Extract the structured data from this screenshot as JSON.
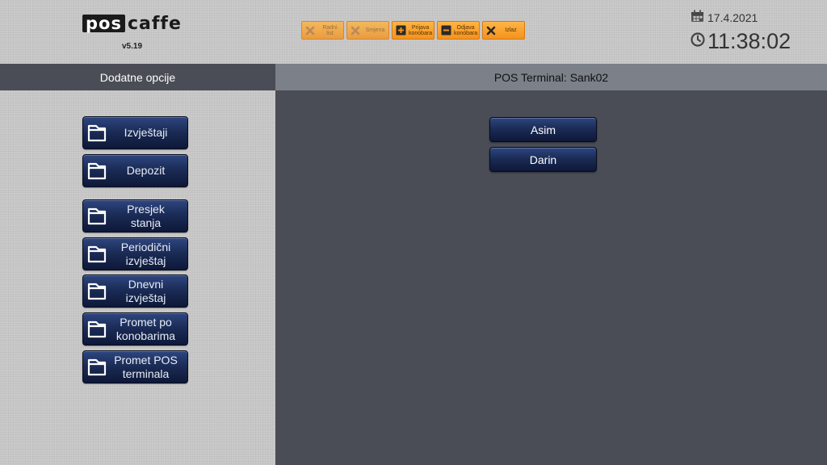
{
  "header": {
    "logo_pos": "pos",
    "logo_caffe": "caffe",
    "version": "v5.19",
    "toolbar": [
      {
        "label": "Radni\nlist",
        "icon": "x-icon",
        "enabled": false
      },
      {
        "label": "Smjena",
        "icon": "x-icon",
        "enabled": false
      },
      {
        "label": "Prijava\nkonobara",
        "icon": "plus-icon",
        "enabled": true
      },
      {
        "label": "Odjava\nkonobara",
        "icon": "minus-icon",
        "enabled": true
      },
      {
        "label": "Izlaz",
        "icon": "x-icon",
        "enabled": true
      }
    ],
    "date": "17.4.2021",
    "time": "11:38:02"
  },
  "left_panel": {
    "title": "Dodatne opcije",
    "buttons": [
      {
        "label": "Izvještaji",
        "icon": "document-icon"
      },
      {
        "label": "Depozit",
        "icon": "document-icon"
      },
      {
        "label": "Presjek\nstanja",
        "icon": "document-icon"
      },
      {
        "label": "Periodični\nizvještaj",
        "icon": "document-icon"
      },
      {
        "label": "Dnevni\nizvještaj",
        "icon": "document-icon"
      },
      {
        "label": "Promet po\nkonobarima",
        "icon": "document-icon"
      },
      {
        "label": "Promet POS\nterminala",
        "icon": "document-icon"
      }
    ]
  },
  "right_panel": {
    "title": "POS Terminal: Sank02",
    "waiters": [
      "Asim",
      "Darin"
    ]
  },
  "colors": {
    "toolbar_orange": "#f4921d",
    "button_navy": "#1b2c57",
    "panel_dark": "#4a4d56",
    "header_gray": "#7b8089"
  }
}
